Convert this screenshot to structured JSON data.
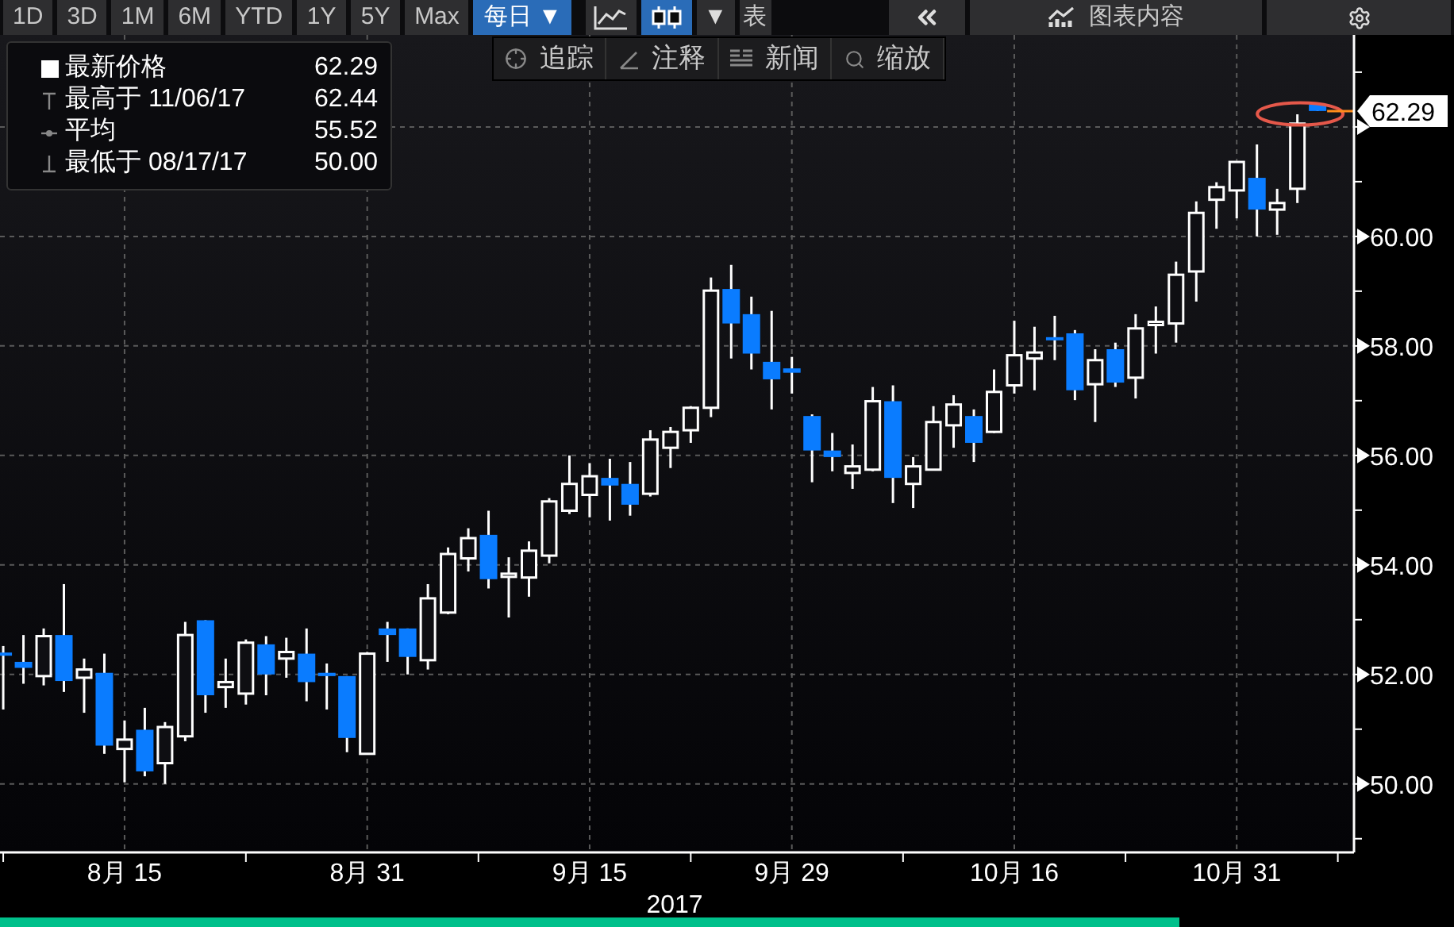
{
  "toolbar": {
    "ranges": [
      {
        "label": "1D",
        "selected": false
      },
      {
        "label": "3D",
        "selected": false
      },
      {
        "label": "1M",
        "selected": false
      },
      {
        "label": "6M",
        "selected": false
      },
      {
        "label": "YTD",
        "selected": false
      },
      {
        "label": "1Y",
        "selected": false
      },
      {
        "label": "5Y",
        "selected": false
      },
      {
        "label": "Max",
        "selected": false
      }
    ],
    "frequency": {
      "label": "每日 ▼",
      "selected": true
    },
    "chart_types": [
      {
        "kind": "line",
        "selected": false
      },
      {
        "kind": "candle",
        "selected": true
      }
    ],
    "type_menu": "▼",
    "table_button": "表",
    "chart_content": "图表内容"
  },
  "tools": [
    {
      "kind": "crosshair",
      "label": "追踪"
    },
    {
      "kind": "pencil",
      "label": "注释"
    },
    {
      "kind": "news",
      "label": "新闻"
    },
    {
      "kind": "zoom",
      "label": "缩放"
    }
  ],
  "legend": [
    {
      "kind": "last",
      "label": "最新价格",
      "value": "62.29"
    },
    {
      "kind": "high",
      "label": "最高于 11/06/17",
      "value": "62.44"
    },
    {
      "kind": "average",
      "label": "平均",
      "value": "55.52"
    },
    {
      "kind": "low",
      "label": "最低于 08/17/17",
      "value": "50.00"
    }
  ],
  "price_tag": "62.29",
  "chart_data": {
    "type": "candlestick",
    "grid": true,
    "ylim": [
      48.75,
      63.68
    ],
    "categories": [
      null,
      null,
      null,
      null,
      null,
      null,
      "8月 15",
      null,
      null,
      null,
      null,
      null,
      null,
      null,
      null,
      null,
      null,
      null,
      "8月 31",
      null,
      null,
      null,
      null,
      null,
      null,
      null,
      null,
      null,
      null,
      "9月 15",
      null,
      null,
      null,
      null,
      null,
      null,
      null,
      null,
      null,
      "9月 29",
      null,
      null,
      null,
      null,
      null,
      null,
      null,
      null,
      null,
      null,
      "10月 16",
      null,
      null,
      null,
      null,
      null,
      null,
      null,
      null,
      null,
      null,
      "10月 31",
      null,
      null,
      null,
      null
    ],
    "yticks": [
      {
        "value": 50,
        "label": "50.00"
      },
      {
        "value": 52,
        "label": "52.00"
      },
      {
        "value": 54,
        "label": "54.00"
      },
      {
        "value": 56,
        "label": "56.00"
      },
      {
        "value": 58,
        "label": "58.00"
      },
      {
        "value": 60,
        "label": "60.00"
      }
    ],
    "ohlc": [
      [
        52.4,
        52.52,
        51.36,
        52.36
      ],
      [
        52.23,
        52.72,
        51.83,
        52.12
      ],
      [
        51.97,
        52.84,
        51.8,
        52.7
      ],
      [
        52.72,
        53.65,
        51.68,
        51.88
      ],
      [
        51.94,
        52.29,
        51.3,
        52.09
      ],
      [
        52.03,
        52.38,
        50.55,
        50.7
      ],
      [
        50.64,
        51.16,
        50.03,
        50.81
      ],
      [
        50.99,
        51.39,
        50.14,
        50.23
      ],
      [
        50.38,
        51.13,
        50.0,
        51.04
      ],
      [
        50.87,
        52.96,
        50.78,
        52.72
      ],
      [
        52.99,
        52.99,
        51.3,
        51.62
      ],
      [
        51.77,
        52.29,
        51.39,
        51.86
      ],
      [
        51.65,
        52.64,
        51.45,
        52.58
      ],
      [
        52.55,
        52.7,
        51.62,
        52.0
      ],
      [
        52.29,
        52.67,
        51.94,
        52.41
      ],
      [
        52.38,
        52.84,
        51.51,
        51.86
      ],
      [
        52.03,
        52.2,
        51.36,
        51.97
      ],
      [
        51.97,
        51.97,
        50.58,
        50.84
      ],
      [
        50.55,
        52.41,
        50.55,
        52.38
      ],
      [
        52.84,
        52.96,
        52.23,
        52.72
      ],
      [
        52.84,
        52.84,
        52.0,
        52.32
      ],
      [
        52.26,
        53.65,
        52.09,
        53.39
      ],
      [
        53.13,
        54.32,
        53.1,
        54.2
      ],
      [
        54.12,
        54.67,
        53.88,
        54.49
      ],
      [
        54.55,
        54.99,
        53.57,
        53.74
      ],
      [
        53.82,
        54.14,
        53.04,
        53.84
      ],
      [
        53.77,
        54.43,
        53.42,
        54.26
      ],
      [
        54.17,
        55.22,
        54.03,
        55.16
      ],
      [
        54.99,
        56.0,
        54.93,
        55.48
      ],
      [
        55.28,
        55.86,
        54.87,
        55.62
      ],
      [
        55.59,
        55.94,
        54.81,
        55.45
      ],
      [
        55.48,
        55.88,
        54.9,
        55.1
      ],
      [
        55.3,
        56.46,
        55.25,
        56.29
      ],
      [
        56.14,
        56.52,
        55.77,
        56.43
      ],
      [
        56.46,
        56.9,
        56.23,
        56.87
      ],
      [
        56.87,
        59.25,
        56.7,
        59.01
      ],
      [
        59.04,
        59.48,
        57.77,
        58.41
      ],
      [
        58.58,
        58.9,
        57.57,
        57.86
      ],
      [
        57.71,
        58.64,
        56.84,
        57.39
      ],
      [
        57.59,
        57.8,
        57.13,
        57.51
      ],
      [
        56.72,
        56.75,
        55.51,
        56.09
      ],
      [
        56.09,
        56.41,
        55.71,
        55.97
      ],
      [
        55.68,
        56.2,
        55.39,
        55.8
      ],
      [
        55.74,
        57.25,
        55.71,
        56.99
      ],
      [
        56.99,
        57.28,
        55.13,
        55.59
      ],
      [
        55.48,
        55.97,
        55.04,
        55.8
      ],
      [
        55.74,
        56.9,
        55.74,
        56.61
      ],
      [
        56.55,
        57.1,
        56.14,
        56.93
      ],
      [
        56.72,
        56.84,
        55.88,
        56.23
      ],
      [
        56.43,
        57.57,
        56.41,
        57.16
      ],
      [
        57.28,
        58.46,
        57.13,
        57.83
      ],
      [
        57.77,
        58.35,
        57.19,
        57.88
      ],
      [
        58.16,
        58.55,
        57.74,
        58.12
      ],
      [
        58.23,
        58.29,
        57.01,
        57.19
      ],
      [
        57.3,
        57.94,
        56.61,
        57.74
      ],
      [
        57.94,
        58.06,
        57.25,
        57.33
      ],
      [
        57.42,
        58.58,
        57.04,
        58.32
      ],
      [
        58.42,
        58.72,
        57.86,
        58.44
      ],
      [
        58.41,
        59.54,
        58.06,
        59.3
      ],
      [
        59.36,
        60.64,
        58.81,
        60.43
      ],
      [
        60.67,
        60.99,
        60.14,
        60.9
      ],
      [
        60.84,
        61.36,
        60.33,
        61.36
      ],
      [
        61.07,
        61.68,
        60.0,
        60.49
      ],
      [
        60.49,
        60.87,
        60.03,
        60.61
      ],
      [
        60.87,
        62.23,
        60.61,
        62.06
      ],
      [
        62.41,
        62.44,
        62.29,
        62.29
      ]
    ]
  },
  "year": "2017"
}
